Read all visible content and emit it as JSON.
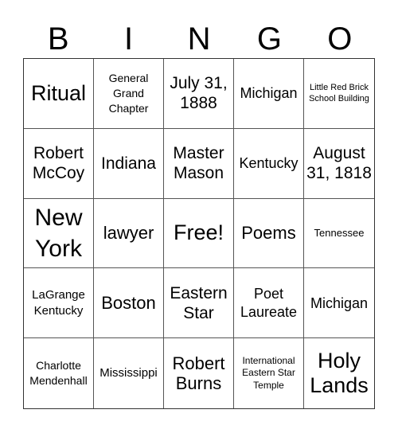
{
  "header": [
    "B",
    "I",
    "N",
    "G",
    "O"
  ],
  "cells": [
    "Ritual",
    "General Grand Chapter",
    "July 31, 1888",
    "Michigan",
    "Little Red Brick School Building",
    "Robert McCoy",
    "Indiana",
    "Master Mason",
    "Kentucky",
    "August 31, 1818",
    "New York",
    "lawyer",
    "Free!",
    "Poems",
    "Tennessee",
    "LaGrange Kentucky",
    "Boston",
    "Eastern Star",
    "Poet Laureate",
    "Michigan",
    "Charlotte Mendenhall",
    "Mississippi",
    "Robert Burns",
    "International Eastern Star Temple",
    "Holy Lands"
  ]
}
